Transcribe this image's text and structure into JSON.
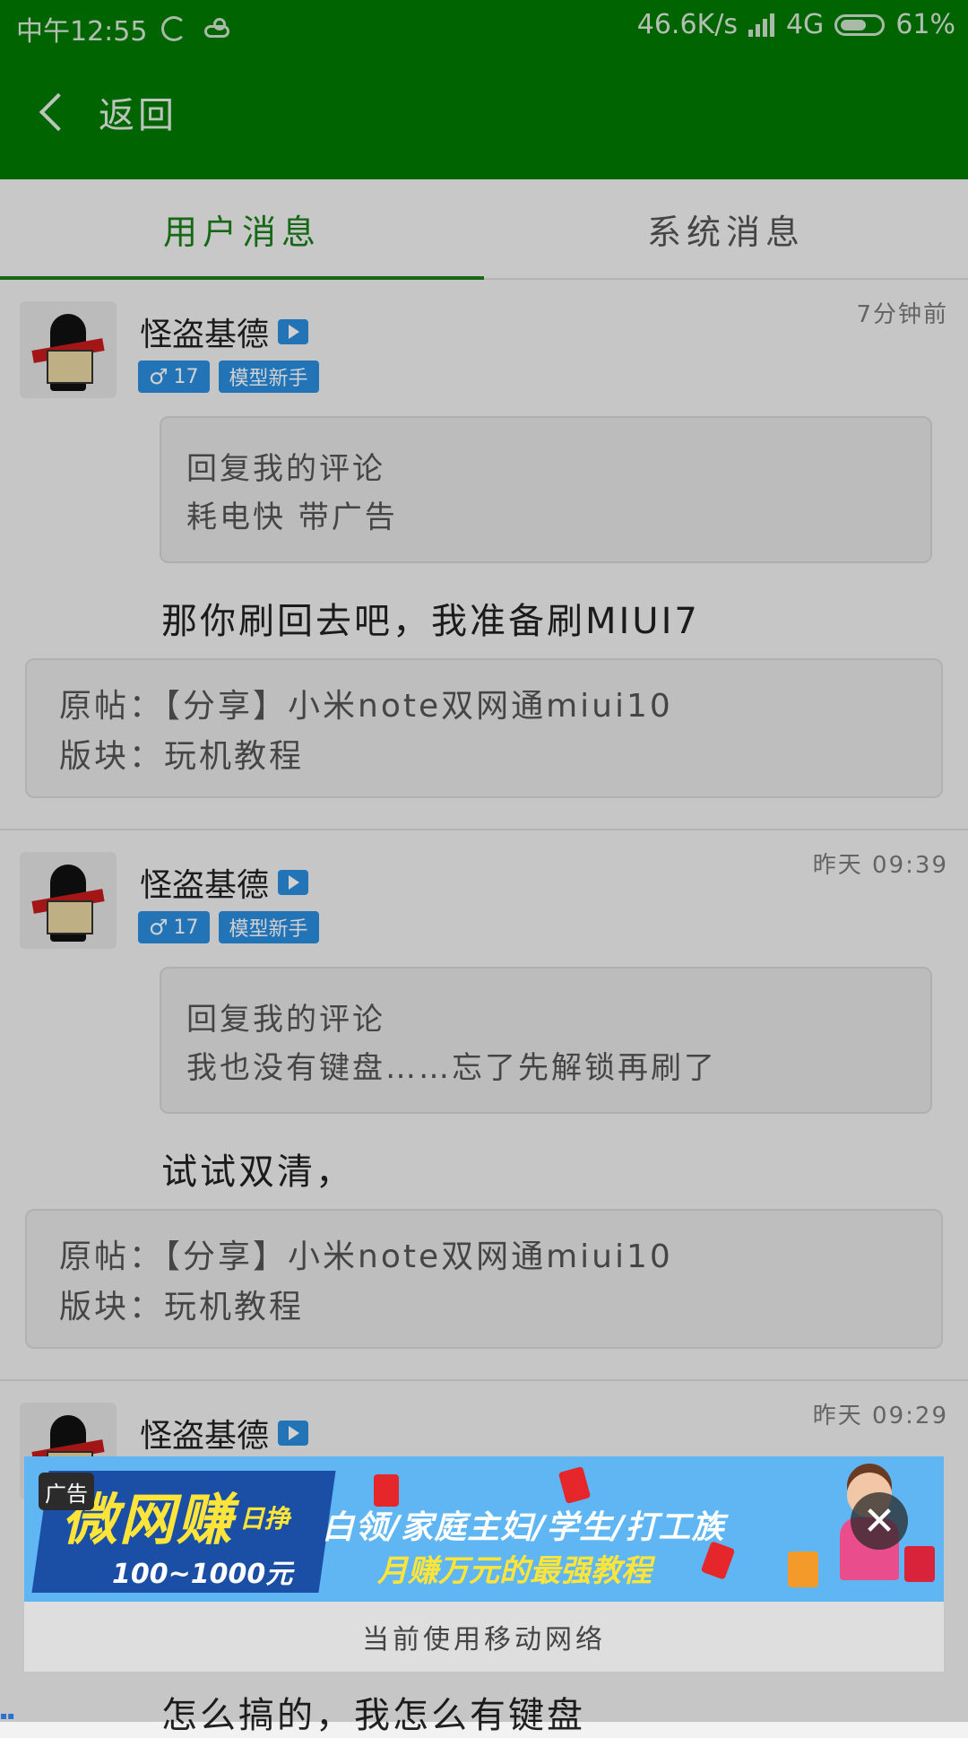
{
  "status_bar": {
    "time": "中午12:55",
    "speed": "46.6K/s",
    "network": "4G",
    "battery": "61%"
  },
  "header": {
    "back_label": "返回"
  },
  "tabs": [
    {
      "label": "用户消息",
      "active": true
    },
    {
      "label": "系统消息",
      "active": false
    }
  ],
  "messages": [
    {
      "username": "怪盗基德",
      "badge_level": "17",
      "badge_rank": "模型新手",
      "time": "7分钟前",
      "quote_title": "回复我的评论",
      "quote_text": "耗电快 带广告",
      "reply": "那你刷回去吧，我准备刷MIUI7",
      "source_post": "原帖：【分享】小米note双网通miui10",
      "source_board": "版块：玩机教程"
    },
    {
      "username": "怪盗基德",
      "badge_level": "17",
      "badge_rank": "模型新手",
      "time": "昨天 09:39",
      "quote_title": "回复我的评论",
      "quote_text": "我也没有键盘……忘了先解锁再刷了",
      "reply": "试试双清，",
      "source_post": "原帖：【分享】小米note双网通miui10",
      "source_board": "版块：玩机教程"
    },
    {
      "username": "怪盗基德",
      "time": "昨天 09:29",
      "reply": "怎么搞的，我怎么有键盘"
    }
  ],
  "ad": {
    "tag": "广告",
    "headline": "微网赚",
    "daily": "日挣",
    "range": "100~1000元",
    "line1": "白领/家庭主妇/学生/打工族",
    "line2": "月赚万元的最强教程",
    "footer": "当前使用移动网络"
  },
  "colors": {
    "brand_green": "#007b00",
    "tab_active": "#1b7f1b",
    "badge_blue": "#2a8ee0"
  }
}
